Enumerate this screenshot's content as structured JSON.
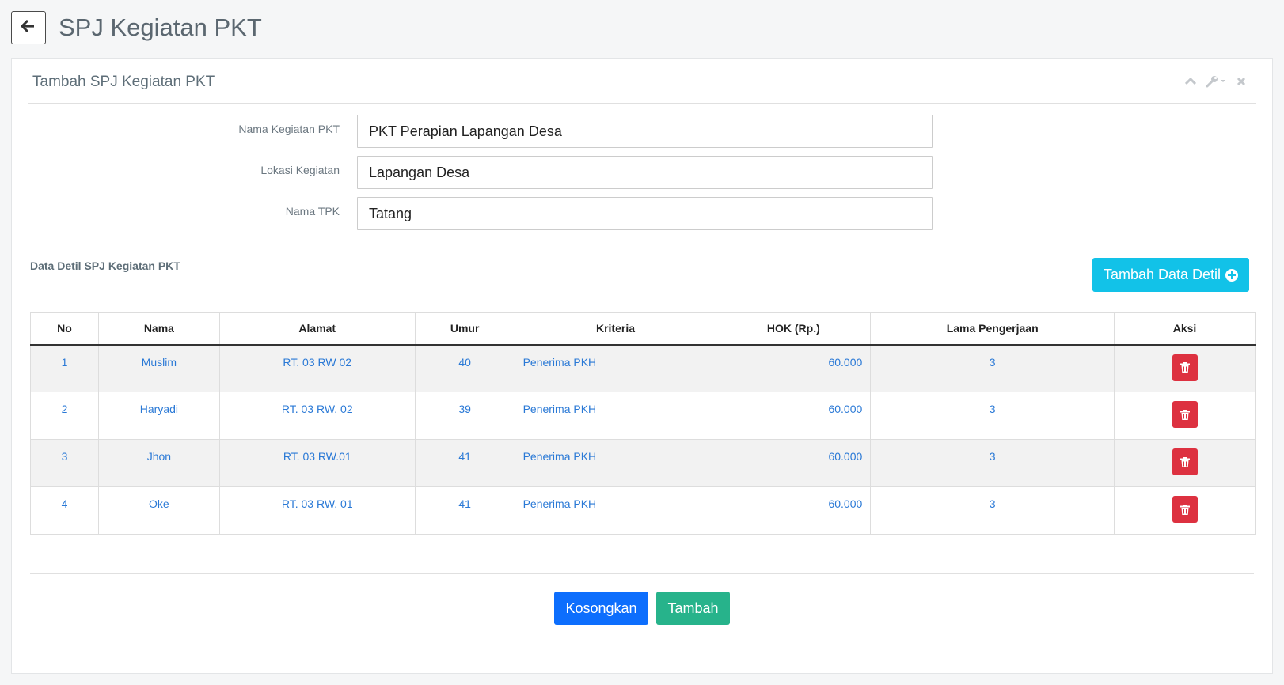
{
  "page": {
    "title": "SPJ Kegiatan PKT"
  },
  "panel": {
    "title": "Tambah SPJ Kegiatan PKT"
  },
  "form": {
    "fields": [
      {
        "label": "Nama Kegiatan PKT",
        "value": "PKT Perapian Lapangan Desa"
      },
      {
        "label": "Lokasi Kegiatan",
        "value": "Lapangan Desa"
      },
      {
        "label": "Nama TPK",
        "value": "Tatang"
      }
    ]
  },
  "detail": {
    "section_title": "Data Detil SPJ Kegiatan PKT",
    "add_button": "Tambah Data Detil",
    "columns": [
      "No",
      "Nama",
      "Alamat",
      "Umur",
      "Kriteria",
      "HOK (Rp.)",
      "Lama Pengerjaan",
      "Aksi"
    ],
    "rows": [
      {
        "no": "1",
        "nama": "Muslim",
        "alamat": "RT. 03 RW 02",
        "umur": "40",
        "kriteria": "Penerima PKH",
        "hok": "60.000",
        "lama": "3"
      },
      {
        "no": "2",
        "nama": "Haryadi",
        "alamat": "RT. 03 RW. 02",
        "umur": "39",
        "kriteria": "Penerima PKH",
        "hok": "60.000",
        "lama": "3"
      },
      {
        "no": "3",
        "nama": "Jhon",
        "alamat": "RT. 03 RW.01",
        "umur": "41",
        "kriteria": "Penerima PKH",
        "hok": "60.000",
        "lama": "3"
      },
      {
        "no": "4",
        "nama": "Oke",
        "alamat": "RT. 03 RW. 01",
        "umur": "41",
        "kriteria": "Penerima PKH",
        "hok": "60.000",
        "lama": "3"
      }
    ]
  },
  "footer": {
    "reset_label": "Kosongkan",
    "submit_label": "Tambah"
  },
  "icons": {
    "back": "arrow-left-icon",
    "collapse": "chevron-up-icon",
    "settings": "wrench-icon",
    "close": "close-icon",
    "add": "plus-circle-icon",
    "delete": "trash-icon"
  },
  "colors": {
    "info": "#12c2e8",
    "primary": "#0d6efd",
    "success": "#27b38b",
    "danger": "#dd3140",
    "link": "#2a79d6"
  }
}
